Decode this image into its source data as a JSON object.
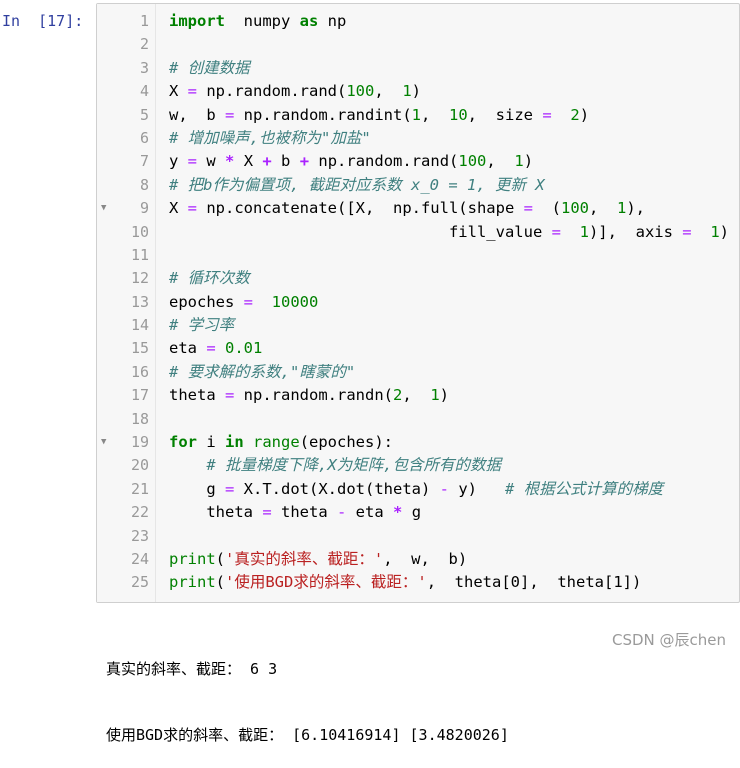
{
  "cell": {
    "prompt": "In  [17]:",
    "lines": [
      {
        "n": "1",
        "fold": "",
        "tokens": [
          [
            "kw",
            "import"
          ],
          [
            "",
            "  numpy "
          ],
          [
            "kw",
            "as"
          ],
          [
            "",
            " np"
          ]
        ]
      },
      {
        "n": "2",
        "fold": "",
        "tokens": []
      },
      {
        "n": "3",
        "fold": "",
        "tokens": [
          [
            "cm",
            "# 创建数据"
          ]
        ]
      },
      {
        "n": "4",
        "fold": "",
        "tokens": [
          [
            "",
            "X "
          ],
          [
            "opn",
            "="
          ],
          [
            "",
            " np.random.rand("
          ],
          [
            "num",
            "100"
          ],
          [
            "",
            ",  "
          ],
          [
            "num",
            "1"
          ],
          [
            "",
            ")"
          ]
        ]
      },
      {
        "n": "5",
        "fold": "",
        "tokens": [
          [
            "",
            "w,  b "
          ],
          [
            "opn",
            "="
          ],
          [
            "",
            " np.random.randint("
          ],
          [
            "num",
            "1"
          ],
          [
            "",
            ",  "
          ],
          [
            "num",
            "10"
          ],
          [
            "",
            ",  size "
          ],
          [
            "opn",
            "="
          ],
          [
            "",
            "  "
          ],
          [
            "num",
            "2"
          ],
          [
            "",
            ")"
          ]
        ]
      },
      {
        "n": "6",
        "fold": "",
        "tokens": [
          [
            "cm",
            "# 增加噪声,也被称为\"加盐\""
          ]
        ]
      },
      {
        "n": "7",
        "fold": "",
        "tokens": [
          [
            "",
            "y "
          ],
          [
            "opn",
            "="
          ],
          [
            "",
            " w "
          ],
          [
            "op",
            "*"
          ],
          [
            "",
            " X "
          ],
          [
            "op",
            "+"
          ],
          [
            "",
            " b "
          ],
          [
            "op",
            "+"
          ],
          [
            "",
            " np.random.rand("
          ],
          [
            "num",
            "100"
          ],
          [
            "",
            ",  "
          ],
          [
            "num",
            "1"
          ],
          [
            "",
            ")"
          ]
        ]
      },
      {
        "n": "8",
        "fold": "",
        "tokens": [
          [
            "cm",
            "# 把b作为偏置项, 截距对应系数 x_0 = 1, 更新 X"
          ]
        ]
      },
      {
        "n": "9",
        "fold": "▼",
        "tokens": [
          [
            "",
            "X "
          ],
          [
            "opn",
            "="
          ],
          [
            "",
            " np.concatenate([X,  np.full(shape "
          ],
          [
            "opn",
            "="
          ],
          [
            "",
            "  ("
          ],
          [
            "num",
            "100"
          ],
          [
            "",
            ",  "
          ],
          [
            "num",
            "1"
          ],
          [
            "",
            "),"
          ]
        ]
      },
      {
        "n": "10",
        "fold": "",
        "tokens": [
          [
            "",
            "                              fill_value "
          ],
          [
            "opn",
            "="
          ],
          [
            "",
            "  "
          ],
          [
            "num",
            "1"
          ],
          [
            "",
            ")],  axis "
          ],
          [
            "opn",
            "="
          ],
          [
            "",
            "  "
          ],
          [
            "num",
            "1"
          ],
          [
            "",
            ")"
          ]
        ]
      },
      {
        "n": "11",
        "fold": "",
        "tokens": []
      },
      {
        "n": "12",
        "fold": "",
        "tokens": [
          [
            "cm",
            "# 循环次数"
          ]
        ]
      },
      {
        "n": "13",
        "fold": "",
        "tokens": [
          [
            "",
            "epoches "
          ],
          [
            "opn",
            "="
          ],
          [
            "",
            "  "
          ],
          [
            "num",
            "10000"
          ]
        ]
      },
      {
        "n": "14",
        "fold": "",
        "tokens": [
          [
            "cm",
            "# 学习率"
          ]
        ]
      },
      {
        "n": "15",
        "fold": "",
        "tokens": [
          [
            "",
            "eta "
          ],
          [
            "opn",
            "="
          ],
          [
            "",
            " "
          ],
          [
            "num",
            "0.01"
          ]
        ]
      },
      {
        "n": "16",
        "fold": "",
        "tokens": [
          [
            "cm",
            "# 要求解的系数,\"瞎蒙的\""
          ]
        ]
      },
      {
        "n": "17",
        "fold": "",
        "tokens": [
          [
            "",
            "theta "
          ],
          [
            "opn",
            "="
          ],
          [
            "",
            " np.random.randn("
          ],
          [
            "num",
            "2"
          ],
          [
            "",
            ",  "
          ],
          [
            "num",
            "1"
          ],
          [
            "",
            ")"
          ]
        ]
      },
      {
        "n": "18",
        "fold": "",
        "tokens": []
      },
      {
        "n": "19",
        "fold": "▼",
        "tokens": [
          [
            "kw",
            "for"
          ],
          [
            "",
            " i "
          ],
          [
            "kw",
            "in"
          ],
          [
            "",
            " "
          ],
          [
            "bi",
            "range"
          ],
          [
            "",
            "(epoches):"
          ]
        ]
      },
      {
        "n": "20",
        "fold": "",
        "tokens": [
          [
            "",
            "    "
          ],
          [
            "cm",
            "# 批量梯度下降,X为矩阵,包含所有的数据"
          ]
        ]
      },
      {
        "n": "21",
        "fold": "",
        "tokens": [
          [
            "",
            "    g "
          ],
          [
            "opn",
            "="
          ],
          [
            "",
            " X.T.dot(X.dot(theta) "
          ],
          [
            "opn",
            "-"
          ],
          [
            "",
            " y)   "
          ],
          [
            "cm",
            "# 根据公式计算的梯度"
          ]
        ]
      },
      {
        "n": "22",
        "fold": "",
        "tokens": [
          [
            "",
            "    theta "
          ],
          [
            "opn",
            "="
          ],
          [
            "",
            " theta "
          ],
          [
            "opn",
            "-"
          ],
          [
            "",
            " eta "
          ],
          [
            "op",
            "*"
          ],
          [
            "",
            " g"
          ]
        ]
      },
      {
        "n": "23",
        "fold": "",
        "tokens": []
      },
      {
        "n": "24",
        "fold": "",
        "tokens": [
          [
            "bi",
            "print"
          ],
          [
            "",
            "("
          ],
          [
            "str",
            "'真实的斜率、截距：'"
          ],
          [
            "",
            ",  w,  b)"
          ]
        ]
      },
      {
        "n": "25",
        "fold": "",
        "tokens": [
          [
            "bi",
            "print"
          ],
          [
            "",
            "("
          ],
          [
            "str",
            "'使用BGD求的斜率、截距：'"
          ],
          [
            "",
            ",  theta[0],  theta[1])"
          ]
        ]
      }
    ]
  },
  "output": {
    "line1": "真实的斜率、截距： 6 3",
    "line2": "使用BGD求的斜率、截距： [6.10416914] [3.4820026]"
  },
  "watermark": "CSDN @辰chen"
}
